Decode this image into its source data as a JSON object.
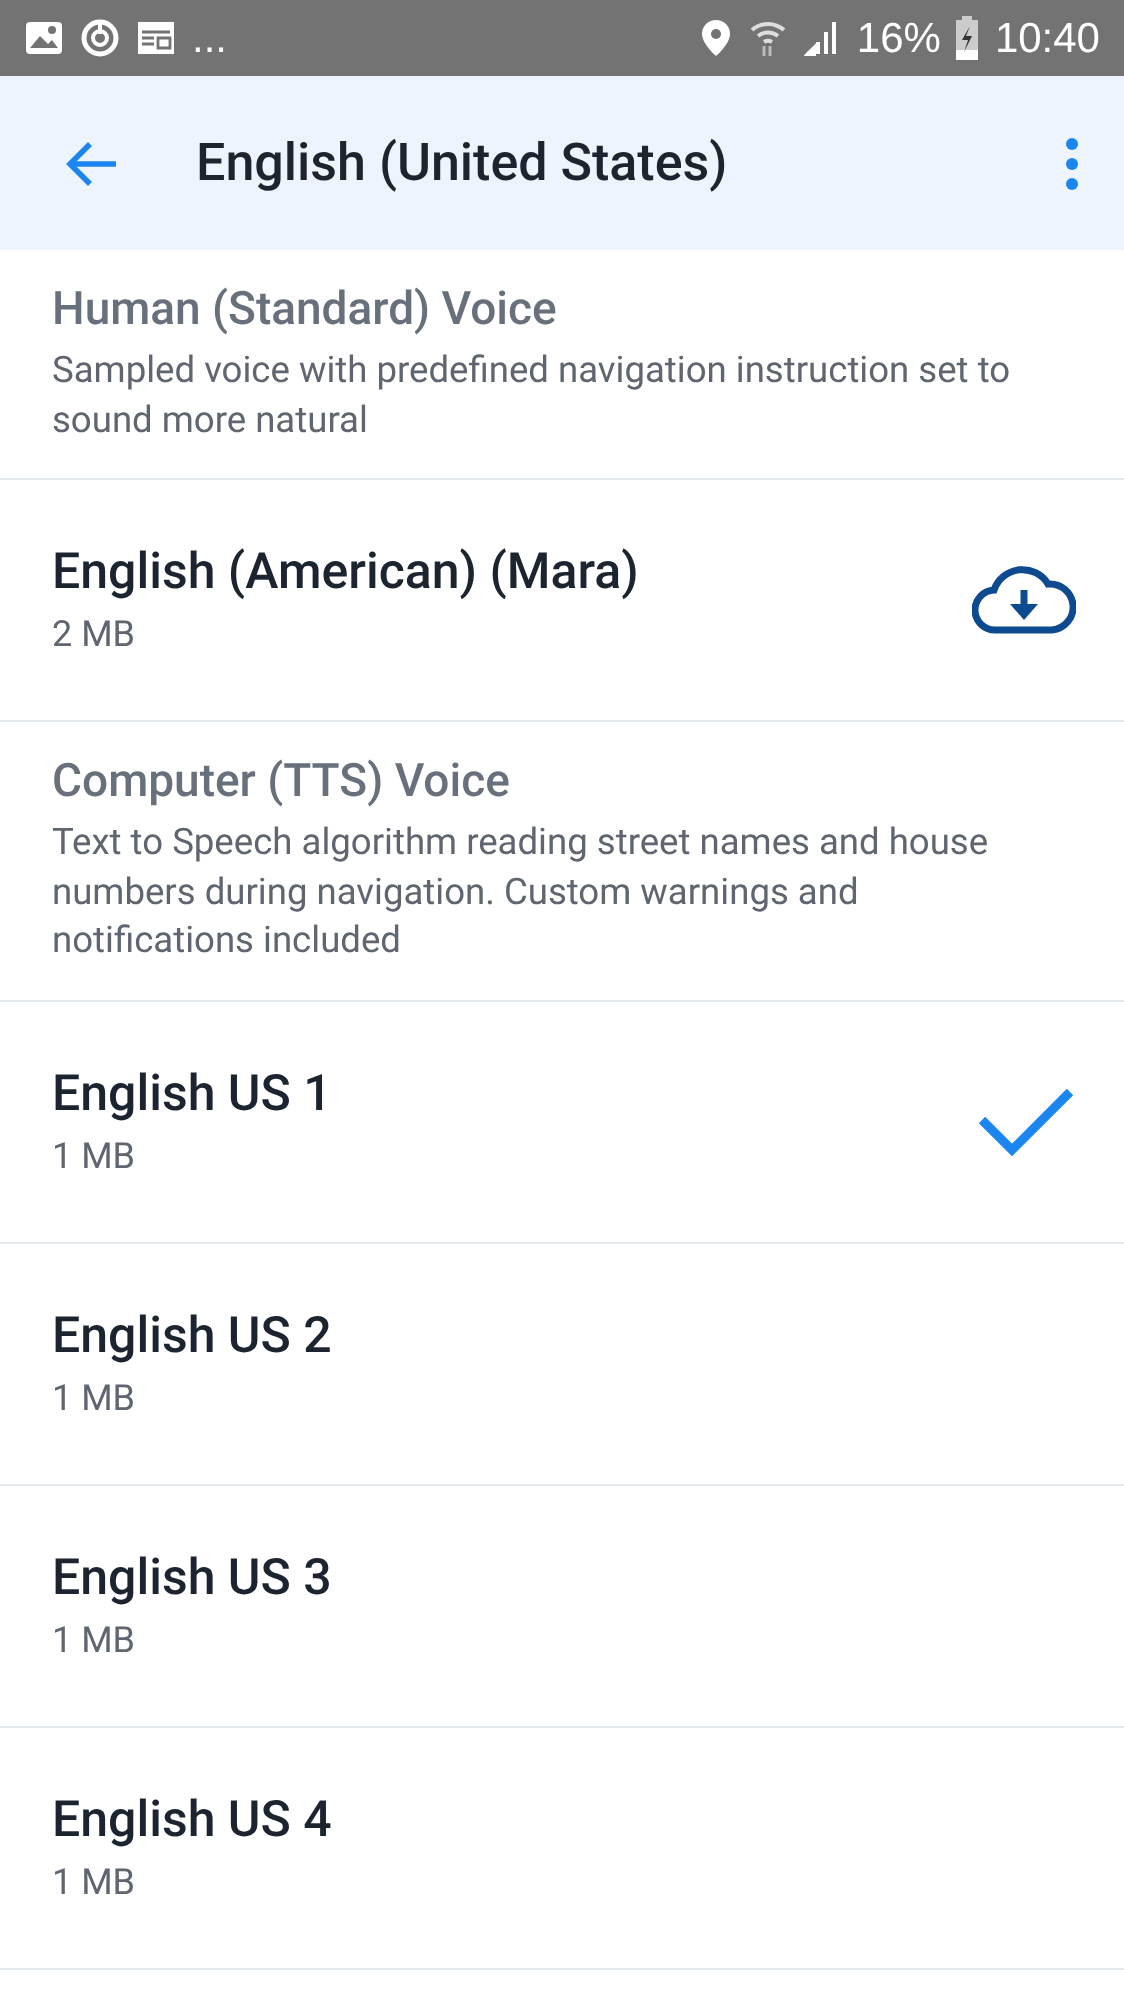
{
  "status_bar": {
    "overflow": "...",
    "battery_percent": "16%",
    "time": "10:40"
  },
  "app_bar": {
    "title": "English (United States)"
  },
  "items": [
    {
      "kind": "section",
      "title": "Human (Standard) Voice",
      "description": "Sampled voice with predefined navigation instruction set to sound more natural"
    },
    {
      "kind": "voice",
      "name": "English (American) (Mara)",
      "size": "2 MB",
      "downloaded": false,
      "selected": false
    },
    {
      "kind": "section",
      "title": "Computer (TTS) Voice",
      "description": "Text to Speech algorithm reading street names and house numbers during navigation. Custom warnings and notifications included"
    },
    {
      "kind": "voice",
      "name": "English US 1",
      "size": "1 MB",
      "downloaded": true,
      "selected": true
    },
    {
      "kind": "voice",
      "name": "English US 2",
      "size": "1 MB",
      "downloaded": true,
      "selected": false
    },
    {
      "kind": "voice",
      "name": "English US 3",
      "size": "1 MB",
      "downloaded": true,
      "selected": false
    },
    {
      "kind": "voice",
      "name": "English US 4",
      "size": "1 MB",
      "downloaded": true,
      "selected": false
    }
  ]
}
